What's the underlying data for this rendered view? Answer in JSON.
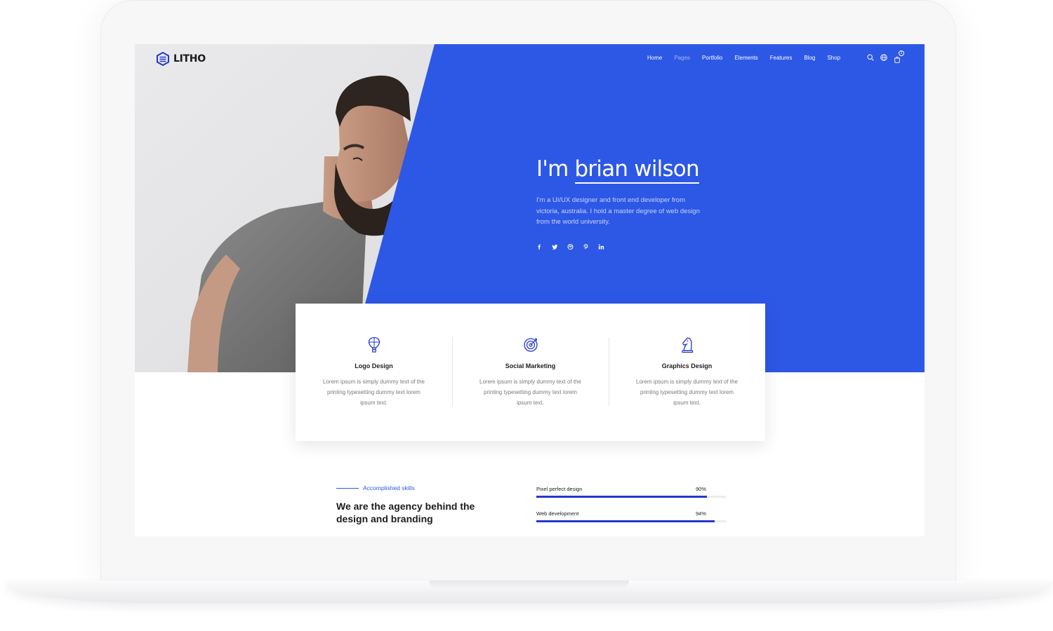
{
  "header": {
    "logo_text": "LITHO",
    "nav": [
      "Home",
      "Pages",
      "Portfolio",
      "Elements",
      "Features",
      "Blog",
      "Shop"
    ],
    "cart_count": "2",
    "icons": [
      "search-icon",
      "globe-icon",
      "cart-icon"
    ]
  },
  "hero": {
    "greeting": "I'm",
    "name": "brian wilson",
    "description": "I'm a UI/UX designer and front end developer from victoria, australia. I hold a master degree of web design from the world university.",
    "socials": [
      "facebook-icon",
      "twitter-icon",
      "dribbble-icon",
      "pinterest-icon",
      "linkedin-icon"
    ]
  },
  "services": [
    {
      "title": "Logo Design",
      "description": "Lorem ipsum is simply dummy text of the printing typesetting dummy text lorem ipsum text.",
      "icon": "hot-air-balloon-icon"
    },
    {
      "title": "Social Marketing",
      "description": "Lorem ipsum is simply dummy text of the printing typesetting dummy text lorem ipsum text.",
      "icon": "target-icon"
    },
    {
      "title": "Graphics Design",
      "description": "Lorem ipsum is simply dummy text of the printing typesetting dummy text lorem ipsum text.",
      "icon": "chess-knight-icon"
    }
  ],
  "skills": {
    "eyebrow": "Accomplished skills",
    "heading": "We are the agency behind the design and branding",
    "items": [
      {
        "label": "Pixel perfect design",
        "percent": "90%",
        "value": 0.9
      },
      {
        "label": "Web development",
        "percent": "94%",
        "value": 0.94
      }
    ]
  },
  "colors": {
    "accent": "#2d58e6",
    "bar": "#2338d0",
    "text_dark": "#1c1c1c"
  }
}
